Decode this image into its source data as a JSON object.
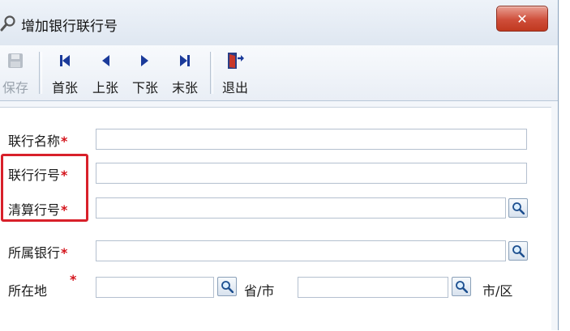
{
  "window": {
    "title": "增加银行联行号",
    "close_label": "✕"
  },
  "toolbar": {
    "save": "保存",
    "first": "首张",
    "prev": "上张",
    "next": "下张",
    "last": "末张",
    "exit": "退出"
  },
  "form": {
    "required_mark": "*",
    "fields": {
      "branch_name": {
        "label": "联行名称",
        "value": ""
      },
      "branch_number": {
        "label": "联行行号",
        "value": ""
      },
      "clearing_number": {
        "label": "清算行号",
        "value": ""
      },
      "bank": {
        "label": "所属银行",
        "value": ""
      },
      "location": {
        "label": "所在地",
        "province_value": "",
        "province_suffix": "省/市",
        "city_value": "",
        "city_suffix": "市/区"
      }
    }
  },
  "colors": {
    "required": "#d4131b",
    "highlight_box": "#d8202a",
    "close_button": "#cf4e3a",
    "nav_icons": "#1a3a9a"
  },
  "icons": {
    "title": "search-key-icon",
    "save": "floppy-disk-icon",
    "first": "first-record-icon",
    "prev": "previous-record-icon",
    "next": "next-record-icon",
    "last": "last-record-icon",
    "exit": "exit-door-icon",
    "lookup": "magnifier-icon"
  }
}
